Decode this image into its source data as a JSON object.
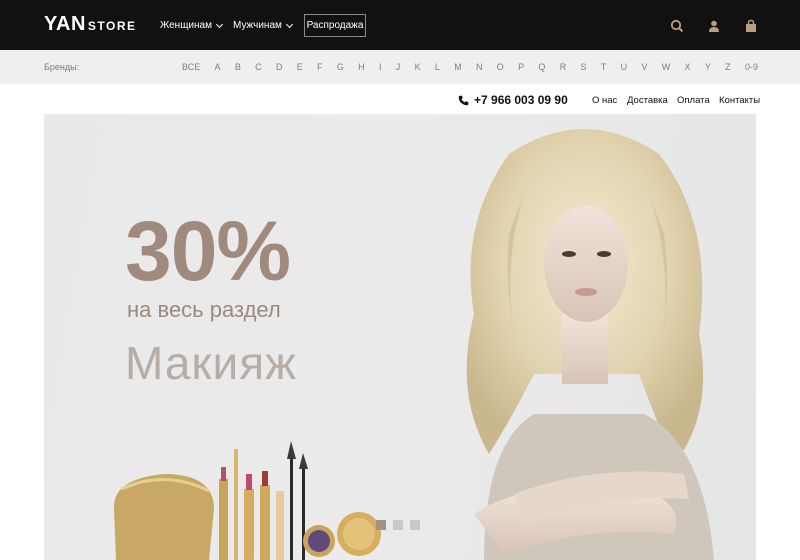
{
  "header": {
    "logo_main": "YAN",
    "logo_sub": "STORE",
    "nav": [
      {
        "label": "Женщинам"
      },
      {
        "label": "Мужчинам"
      }
    ],
    "sale_label": "Распродажа",
    "icons": [
      "search-icon",
      "user-icon",
      "cart-icon"
    ]
  },
  "brands": {
    "label": "Бренды:",
    "letters": [
      "ВСЕ",
      "A",
      "B",
      "C",
      "D",
      "E",
      "F",
      "G",
      "H",
      "I",
      "J",
      "K",
      "L",
      "M",
      "N",
      "O",
      "P",
      "Q",
      "R",
      "S",
      "T",
      "U",
      "V",
      "W",
      "X",
      "Y",
      "Z",
      "0-9"
    ]
  },
  "info": {
    "phone": "+7 966 003 09 90",
    "links": [
      "О нас",
      "Доставка",
      "Оплата",
      "Контакты"
    ]
  },
  "banner": {
    "headline": "30%",
    "subtitle": "на весь раздел",
    "category": "Макияж",
    "slides_count": 3,
    "active_slide": 0,
    "colors": {
      "accent": "#a08a7e",
      "dark": "#111111"
    }
  }
}
